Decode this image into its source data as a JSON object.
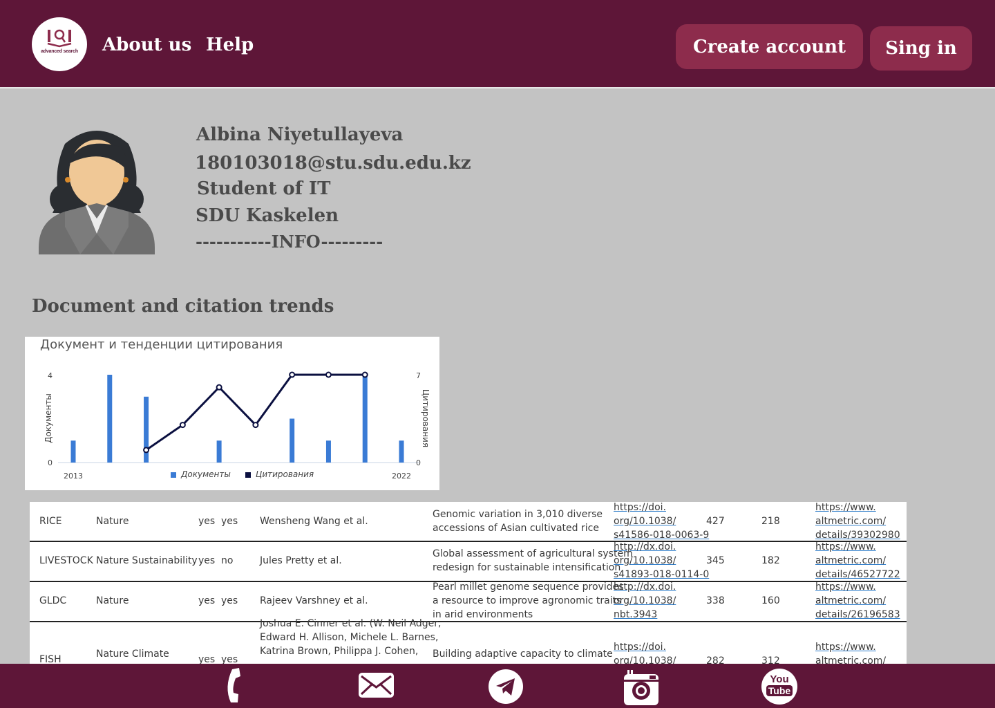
{
  "header": {
    "logo_text": "advanced search",
    "nav": [
      "About us",
      "Help"
    ],
    "create_account": "Create account",
    "sign_in": "Sing in"
  },
  "profile": {
    "name": "Albina Niyetullayeva",
    "email": "180103018@stu.sdu.edu.kz",
    "role": "Student of IT",
    "location": "SDU Kaskelen",
    "info": "-----------INFO---------"
  },
  "section_title": "Document and citation trends",
  "chart_data": {
    "type": "bar",
    "title": "Документ и тенденции цитирования",
    "xlabel": "",
    "x_tick_labels": [
      "2013",
      "2022"
    ],
    "x_range": [
      2013,
      2022
    ],
    "ylabel_left": "Документы",
    "ylabel_right": "Цитирования",
    "ylim_left": [
      0,
      4
    ],
    "ylim_right": [
      0,
      7
    ],
    "legend": [
      "Документы",
      "Цитирования"
    ],
    "legend_position": "bottom",
    "series": [
      {
        "name": "Документы",
        "type": "bar",
        "axis": "left",
        "x": [
          2013,
          2014,
          2015,
          2016,
          2017,
          2018,
          2019,
          2020,
          2021,
          2022
        ],
        "values": [
          1,
          4,
          3,
          0,
          1,
          0,
          2,
          1,
          4,
          1
        ]
      },
      {
        "name": "Цитирования",
        "type": "line",
        "axis": "right",
        "x": [
          2015,
          2016,
          2017,
          2018,
          2019,
          2020,
          2021
        ],
        "values": [
          1,
          3,
          6,
          3,
          7,
          7,
          7
        ]
      }
    ],
    "colors": {
      "bars": "#3a7bd5",
      "line": "#0b1040"
    }
  },
  "table": {
    "rows": [
      {
        "area": "RICE",
        "journal": "Nature",
        "c1": "yes",
        "c2": "yes",
        "authors": [
          "Wensheng Wang et al."
        ],
        "title": [
          "Genomic variation in 3,010 diverse",
          "accessions of Asian cultivated rice"
        ],
        "doi": [
          "https://doi.",
          "org/10.1038/",
          "s41586-018-0063-9"
        ],
        "n1": "427",
        "n2": "218",
        "alt": [
          "https://www.",
          "altmetric.com/",
          "details/39302980"
        ]
      },
      {
        "area": "LIVESTOCK",
        "journal": "Nature Sustainability",
        "c1": "yes",
        "c2": "no",
        "authors": [
          "Jules Pretty et al."
        ],
        "title": [
          "Global assessment of agricultural system",
          "redesign for sustainable intensification"
        ],
        "doi": [
          "http://dx.doi.",
          "org/10.1038/",
          "s41893-018-0114-0"
        ],
        "n1": "345",
        "n2": "182",
        "alt": [
          "https://www.",
          "altmetric.com/",
          "details/46527722"
        ]
      },
      {
        "area": "GLDC",
        "journal": "Nature",
        "c1": "yes",
        "c2": "yes",
        "authors": [
          "Rajeev Varshney et al."
        ],
        "title": [
          "Pearl millet genome sequence provides",
          "a resource to improve agronomic traits",
          "in arid environments"
        ],
        "doi": [
          "http://dx.doi.",
          "org/10.1038/",
          "nbt.3943"
        ],
        "n1": "338",
        "n2": "160",
        "alt": [
          "https://www.",
          "altmetric.com/",
          "details/26196583"
        ]
      },
      {
        "area": "FISH",
        "journal": "Nature Climate",
        "c1": "yes",
        "c2": "yes",
        "authors": [
          "Joshua E. Cinner et al. (W. Neil Adger,",
          "Edward H. Allison, Michele L. Barnes,",
          "Katrina Brown, Philippa J. Cohen,"
        ],
        "title": [
          "Building adaptive capacity to climate"
        ],
        "doi": [
          "https://doi.",
          "org/10.1038/"
        ],
        "n1": "282",
        "n2": "312",
        "alt": [
          "https://www.",
          "altmetric.com/"
        ]
      }
    ]
  },
  "footer": {
    "icons": [
      "phone-icon",
      "mail-icon",
      "telegram-icon",
      "instagram-icon",
      "youtube-icon"
    ],
    "youtube_text_1": "You",
    "youtube_text_2": "Tube"
  }
}
